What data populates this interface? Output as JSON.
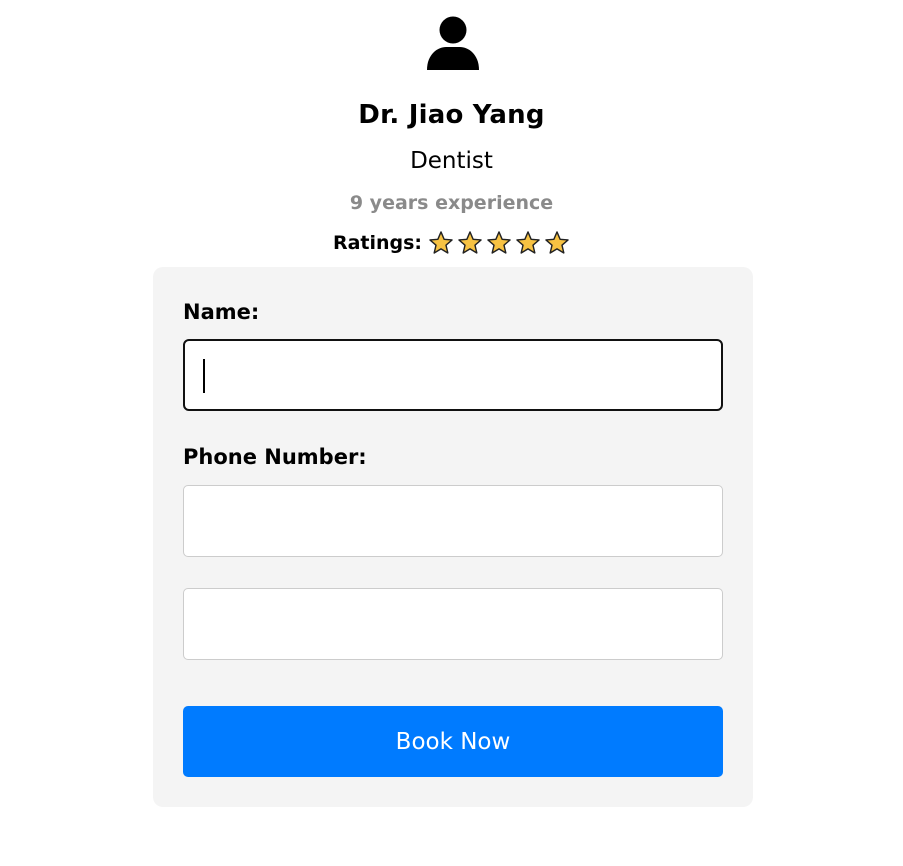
{
  "doctor": {
    "name": "Dr. Jiao Yang",
    "specialty": "Dentist",
    "experience": "9 years experience",
    "ratings_label": "Ratings:",
    "stars": 5,
    "star_color": "#f7c242"
  },
  "form": {
    "name_label": "Name:",
    "name_value": "",
    "phone_label": "Phone Number:",
    "phone_value": "",
    "extra_value": "",
    "submit_label": "Book Now",
    "button_color": "#007bff"
  },
  "icons": {
    "avatar": "user-icon",
    "star": "star-icon"
  }
}
